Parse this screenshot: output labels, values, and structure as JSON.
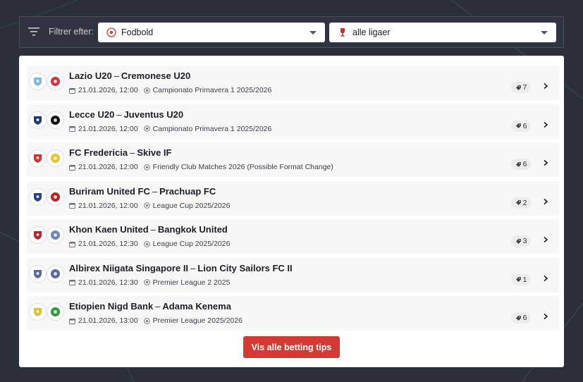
{
  "filter": {
    "label": "Filtrer efter:",
    "sport": "Fodbold",
    "league": "alle ligaer"
  },
  "matches": [
    {
      "home": "Lazio U20",
      "away": "Cremonese U20",
      "datetime": "21.01.2026, 12:00",
      "competition": "Campionato Primavera 1 2025/2026",
      "tips": "7",
      "home_color": "#7fb8e6",
      "away_color": "#d0343a"
    },
    {
      "home": "Lecce U20",
      "away": "Juventus U20",
      "datetime": "21.01.2026, 12:00",
      "competition": "Campionato Primavera 1 2025/2026",
      "tips": "6",
      "home_color": "#1f3a6e",
      "away_color": "#111111"
    },
    {
      "home": "FC Fredericia",
      "away": "Skive IF",
      "datetime": "21.01.2026, 12:00",
      "competition": "Friendly Club Matches 2026 (Possible Format Change)",
      "tips": "6",
      "home_color": "#d62f2f",
      "away_color": "#e6c62a"
    },
    {
      "home": "Buriram United FC",
      "away": "Prachuap FC",
      "datetime": "21.01.2026, 12:00",
      "competition": "League Cup 2025/2026",
      "tips": "2",
      "home_color": "#2b3f8c",
      "away_color": "#b8251f"
    },
    {
      "home": "Khon Kaen United",
      "away": "Bangkok United",
      "datetime": "21.01.2026, 12:30",
      "competition": "League Cup 2025/2026",
      "tips": "3",
      "home_color": "#b0262a",
      "away_color": "#6f86b8"
    },
    {
      "home": "Albirex Niigata Singapore II",
      "away": "Lion City Sailors FC II",
      "datetime": "21.01.2026, 12:30",
      "competition": "Premier League 2 2025",
      "tips": "1",
      "home_color": "#5a6b9a",
      "away_color": "#5a6b9a"
    },
    {
      "home": "Etiopien Nigd Bank",
      "away": "Adama Kenema",
      "datetime": "21.01.2026, 13:00",
      "competition": "Premier League 2025/2026",
      "tips": "6",
      "home_color": "#d8c23a",
      "away_color": "#2f9a3e"
    }
  ],
  "cta_label": "Vis alle betting tips",
  "colors": {
    "background": "#2a2f3a",
    "accent": "#d43a34",
    "row": "#f7f7f8"
  }
}
